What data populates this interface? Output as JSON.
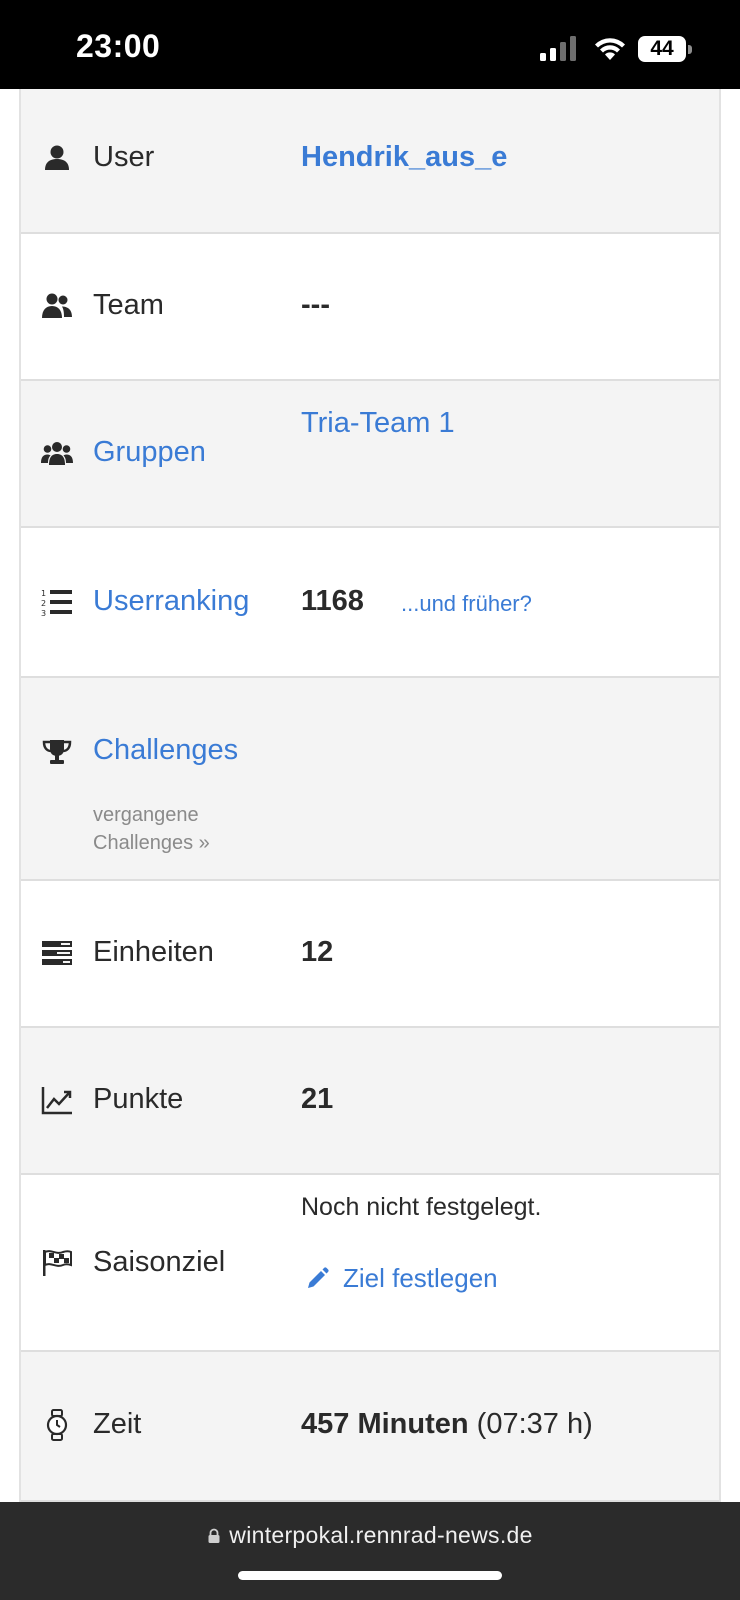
{
  "status_bar": {
    "time": "23:00",
    "battery": "44",
    "icons": [
      "signal-icon",
      "wifi-icon",
      "battery-icon"
    ]
  },
  "rows": {
    "user": {
      "label": "User",
      "value": "Hendrik_aus_e",
      "icon": "user-icon"
    },
    "team": {
      "label": "Team",
      "value": "---",
      "icon": "team-icon"
    },
    "gruppen": {
      "label": "Gruppen",
      "value": "Tria-Team 1",
      "icon": "groups-icon"
    },
    "userranking": {
      "label": "Userranking",
      "value": "1168",
      "extra_link": "...und früher?",
      "icon": "ranked-list-icon"
    },
    "challenges": {
      "label": "Challenges",
      "sub_link_line1": "vergangene",
      "sub_link_line2": "Challenges »",
      "icon": "trophy-icon"
    },
    "einheiten": {
      "label": "Einheiten",
      "value": "12",
      "icon": "tasks-icon"
    },
    "punkte": {
      "label": "Punkte",
      "value": "21",
      "icon": "line-chart-icon"
    },
    "saisonziel": {
      "label": "Saisonziel",
      "value": "Noch nicht festgelegt.",
      "action_link": "Ziel festlegen",
      "icon": "flag-checkered-icon",
      "action_icon": "pencil-icon"
    },
    "zeit": {
      "label": "Zeit",
      "value_bold": "457 Minuten",
      "value_extra": "(07:37 h)",
      "icon": "watch-icon"
    }
  },
  "bottom_bar": {
    "url": "winterpokal.rennrad-news.de",
    "icon": "lock-icon"
  },
  "colors": {
    "link": "#3a7bd5",
    "row_grey": "#f4f4f4",
    "row_white": "#ffffff",
    "status_bar": "#000000",
    "bottom_bar": "#2b2b2b"
  }
}
